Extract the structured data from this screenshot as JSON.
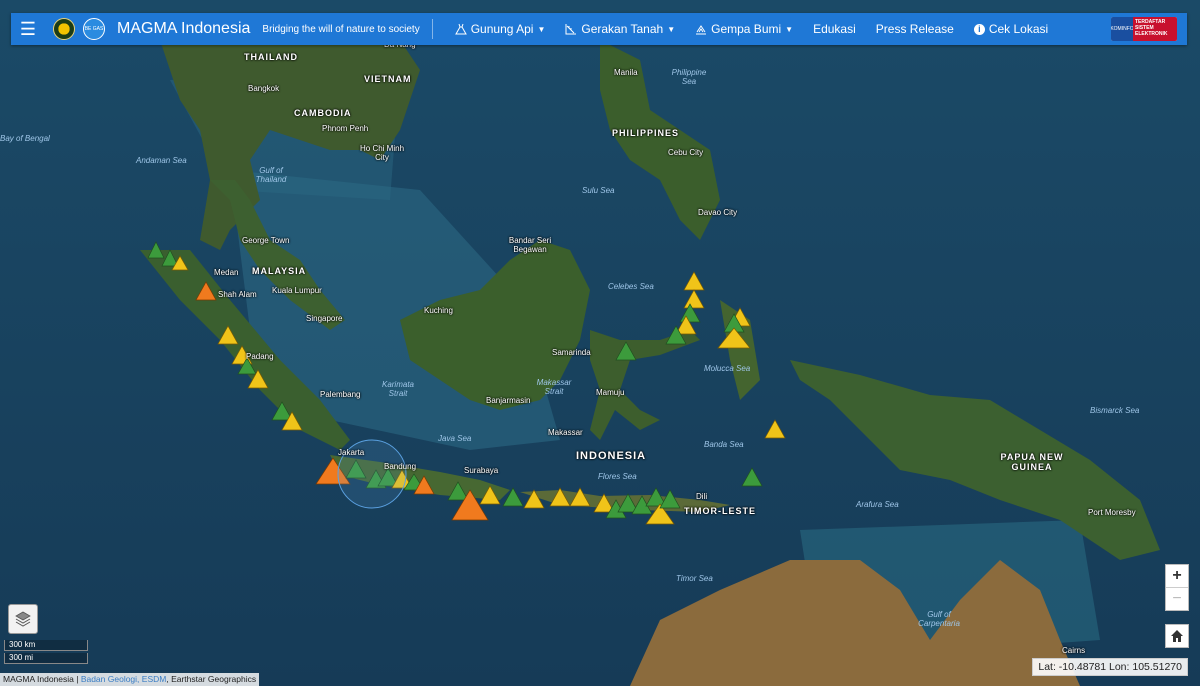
{
  "navbar": {
    "brand": "MAGMA Indonesia",
    "tagline": "Bridging the will of nature to society",
    "logo2_text": "BE GAS",
    "menu": [
      {
        "label": "Gunung Api",
        "icon": "volcano-icon",
        "dropdown": true
      },
      {
        "label": "Gerakan Tanah",
        "icon": "landslide-icon",
        "dropdown": true
      },
      {
        "label": "Gempa Bumi",
        "icon": "earthquake-icon",
        "dropdown": true
      },
      {
        "label": "Edukasi",
        "dropdown": false
      },
      {
        "label": "Press Release",
        "dropdown": false
      },
      {
        "label": "Cek Lokasi",
        "icon": "info-icon",
        "dropdown": false
      }
    ],
    "badge": {
      "left": "KOMINFO",
      "right": "TERDAFTAR SISTEM ELEKTRONIK"
    }
  },
  "map": {
    "country_labels": [
      "THAILAND",
      "VIETNAM",
      "CAMBODIA",
      "MALAYSIA",
      "PHILIPPINES",
      "INDONESIA",
      "PAPUA NEW GUINEA",
      "TIMOR-LESTE"
    ],
    "city_labels": [
      "Bangkok",
      "Phnom Penh",
      "Ho Chi Minh City",
      "Medan",
      "Shah Alam",
      "Kuala Lumpur",
      "Singapore",
      "Palembang",
      "Jakarta",
      "Bandung",
      "Surabaya",
      "Kuching",
      "Bandar Seri Begawan",
      "Samarinda",
      "Banjarmasin",
      "Makassar",
      "Mamuju",
      "Manila",
      "Cebu City",
      "Davao City",
      "Dili",
      "Port Moresby",
      "George Town",
      "Padang",
      "Cairns",
      "Da Nang"
    ],
    "sea_labels": [
      "Bay of Bengal",
      "Andaman Sea",
      "Gulf of Thailand",
      "Sulu Sea",
      "Celebes Sea",
      "Philippine Sea",
      "Java Sea",
      "Flores Sea",
      "Banda Sea",
      "Molucca Sea",
      "Bismarck Sea",
      "Arafura Sea",
      "Timor Sea",
      "Gulf of Carpentaria",
      "Karimata Strait",
      "Makassar Strait"
    ],
    "volcano_status_colors": {
      "normal": "#3c9b3c",
      "waspada": "#f0c419",
      "siaga": "#f07a1e"
    }
  },
  "controls": {
    "scale_km": "300 km",
    "scale_mi": "300 mi",
    "zoom_in": "+",
    "zoom_out": "−",
    "coordinates": "Lat: -10.48781 Lon: 105.51270"
  },
  "attribution": {
    "prefix": "MAGMA Indonesia | ",
    "link": "Badan Geologi, ESDM",
    "suffix": ", Earthstar Geographics"
  }
}
